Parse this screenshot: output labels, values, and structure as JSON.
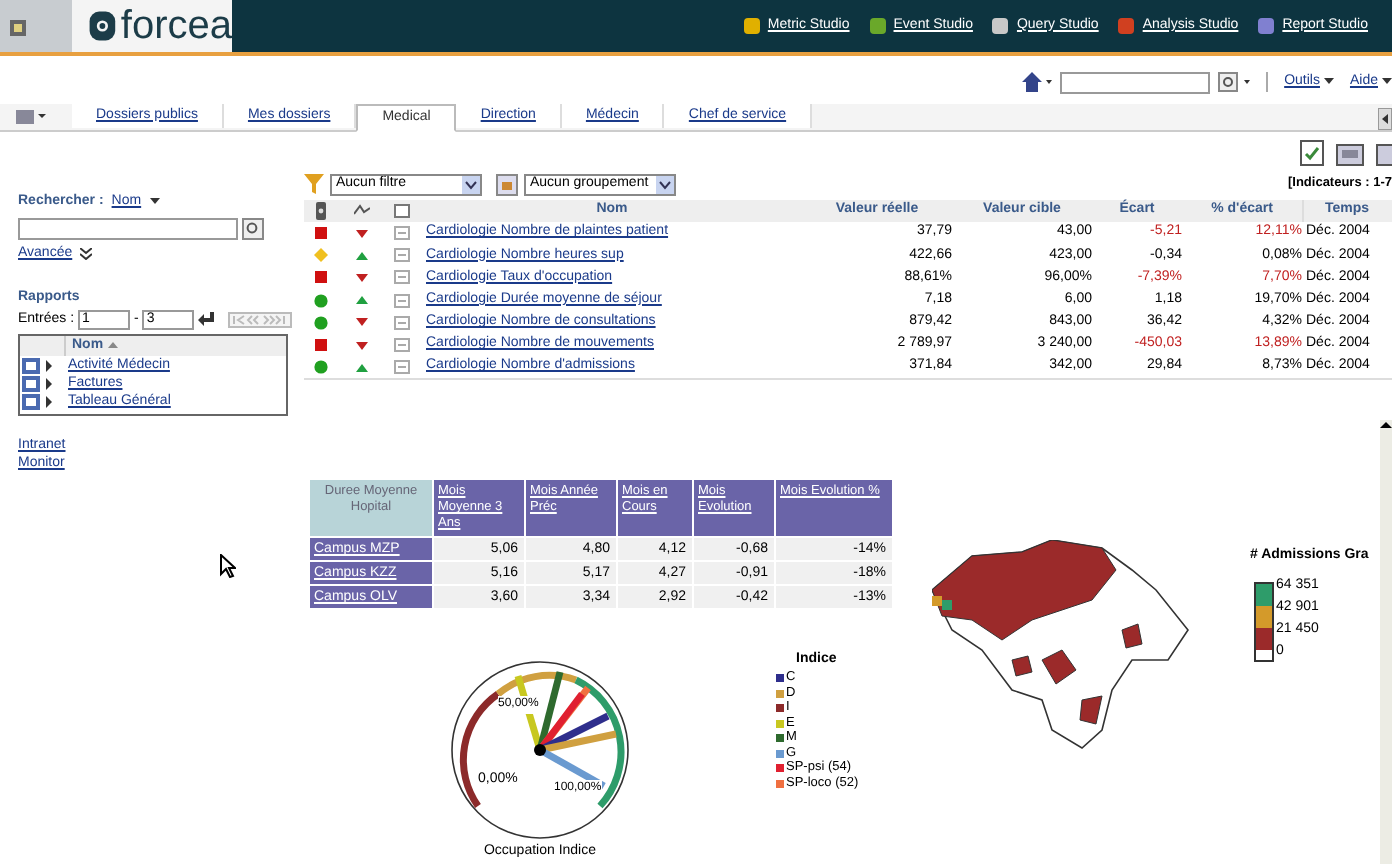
{
  "header": {
    "logo": "forcea",
    "studios": [
      {
        "label": "Metric Studio",
        "color": "#e0b000"
      },
      {
        "label": "Event Studio",
        "color": "#6aa82a"
      },
      {
        "label": "Query Studio",
        "color": "#c8c8c8"
      },
      {
        "label": "Analysis Studio",
        "color": "#d04020"
      },
      {
        "label": "Report Studio",
        "color": "#8080d0"
      }
    ]
  },
  "toolbar": {
    "menus": [
      "Outils",
      "Aide"
    ]
  },
  "tabs": [
    {
      "label": "Dossiers publics",
      "selected": false
    },
    {
      "label": "Mes dossiers",
      "selected": false
    },
    {
      "label": "Medical",
      "selected": true
    },
    {
      "label": "Direction",
      "selected": false
    },
    {
      "label": "Médecin",
      "selected": false
    },
    {
      "label": "Chef de service",
      "selected": false
    }
  ],
  "search": {
    "label": "Rechercher :",
    "mode": "Nom",
    "advanced": "Avancée"
  },
  "reports": {
    "title": "Rapports",
    "entries_label": "Entrées :",
    "from": "1",
    "separator": "-",
    "to": "3",
    "column": "Nom",
    "items": [
      "Activité Médecin",
      "Factures",
      "Tableau Général"
    ]
  },
  "links": [
    "Intranet",
    "Monitor"
  ],
  "filters": {
    "filter": "Aucun filtre",
    "grouping": "Aucun groupement",
    "range": "[Indicateurs : 1-7"
  },
  "indicators": {
    "columns": [
      "Nom",
      "Valeur réelle",
      "Valeur cible",
      "Écart",
      "% d'écart",
      "Temps"
    ],
    "rows": [
      {
        "kind": "square",
        "color": "#d01010",
        "rising": false,
        "name": "Cardiologie Nombre de plaintes patient",
        "actual": "37,79",
        "target": "43,00",
        "gap": "-5,21",
        "pct": "12,11%",
        "time": "Déc. 2004",
        "alert": true
      },
      {
        "kind": "diamond",
        "color": "#f0c020",
        "rising": true,
        "name": "Cardiologie Nombre heures sup",
        "actual": "422,66",
        "target": "423,00",
        "gap": "-0,34",
        "pct": "0,08%",
        "time": "Déc. 2004",
        "alert": false
      },
      {
        "kind": "square",
        "color": "#d01010",
        "rising": false,
        "name": "Cardiologie Taux d'occupation",
        "actual": "88,61%",
        "target": "96,00%",
        "gap": "-7,39%",
        "pct": "7,70%",
        "time": "Déc. 2004",
        "alert": true
      },
      {
        "kind": "circle",
        "color": "#20a020",
        "rising": true,
        "name": "Cardiologie Durée moyenne de séjour",
        "actual": "7,18",
        "target": "6,00",
        "gap": "1,18",
        "pct": "19,70%",
        "time": "Déc. 2004",
        "alert": false
      },
      {
        "kind": "circle",
        "color": "#20a020",
        "rising": false,
        "name": "Cardiologie Nombre de consultations",
        "actual": "879,42",
        "target": "843,00",
        "gap": "36,42",
        "pct": "4,32%",
        "time": "Déc. 2004",
        "alert": false
      },
      {
        "kind": "square",
        "color": "#d01010",
        "rising": false,
        "name": "Cardiologie Nombre de mouvements",
        "actual": "2 789,97",
        "target": "3 240,00",
        "gap": "-450,03",
        "pct": "13,89%",
        "time": "Déc. 2004",
        "alert": true
      },
      {
        "kind": "circle",
        "color": "#20a020",
        "rising": true,
        "name": "Cardiologie Nombre d'admissions",
        "actual": "371,84",
        "target": "342,00",
        "gap": "29,84",
        "pct": "8,73%",
        "time": "Déc. 2004",
        "alert": false
      }
    ]
  },
  "stay_table": {
    "corner": "Duree Moyenne Hopital",
    "columns": [
      "Mois Moyenne 3 Ans",
      "Mois Année Préc",
      "Mois en Cours",
      "Mois Evolution",
      "Mois Evolution %"
    ],
    "rows": [
      {
        "label": "Campus MZP",
        "cells": [
          "5,06",
          "4,80",
          "4,12",
          "-0,68",
          "-14%"
        ]
      },
      {
        "label": "Campus KZZ",
        "cells": [
          "5,16",
          "5,17",
          "4,27",
          "-0,91",
          "-18%"
        ]
      },
      {
        "label": "Campus OLV",
        "cells": [
          "3,60",
          "3,34",
          "2,92",
          "-0,42",
          "-13%"
        ]
      }
    ]
  },
  "gauge": {
    "title": "Occupation Indice",
    "labels": [
      "0,00%",
      "50,00%",
      "100,00%"
    ],
    "legend_title": "Indice",
    "legend": [
      {
        "label": "C",
        "color": "#2e2e8c"
      },
      {
        "label": "D",
        "color": "#d0a040"
      },
      {
        "label": "I",
        "color": "#8c2a2a"
      },
      {
        "label": "E",
        "color": "#c8c820"
      },
      {
        "label": "M",
        "color": "#2e6a2e"
      },
      {
        "label": "G",
        "color": "#6a9ad0"
      },
      {
        "label": "SP-psi (54)",
        "color": "#e02030"
      },
      {
        "label": "SP-loco (52)",
        "color": "#f07040"
      }
    ]
  },
  "map": {
    "legend_title": "# Admissions Gra",
    "bands": [
      {
        "color": "#2e9c6a"
      },
      {
        "color": "#d49a2a"
      },
      {
        "color": "#9b2a2a"
      }
    ],
    "breaks": [
      "64 351",
      "42 901",
      "21 450",
      "0"
    ]
  }
}
